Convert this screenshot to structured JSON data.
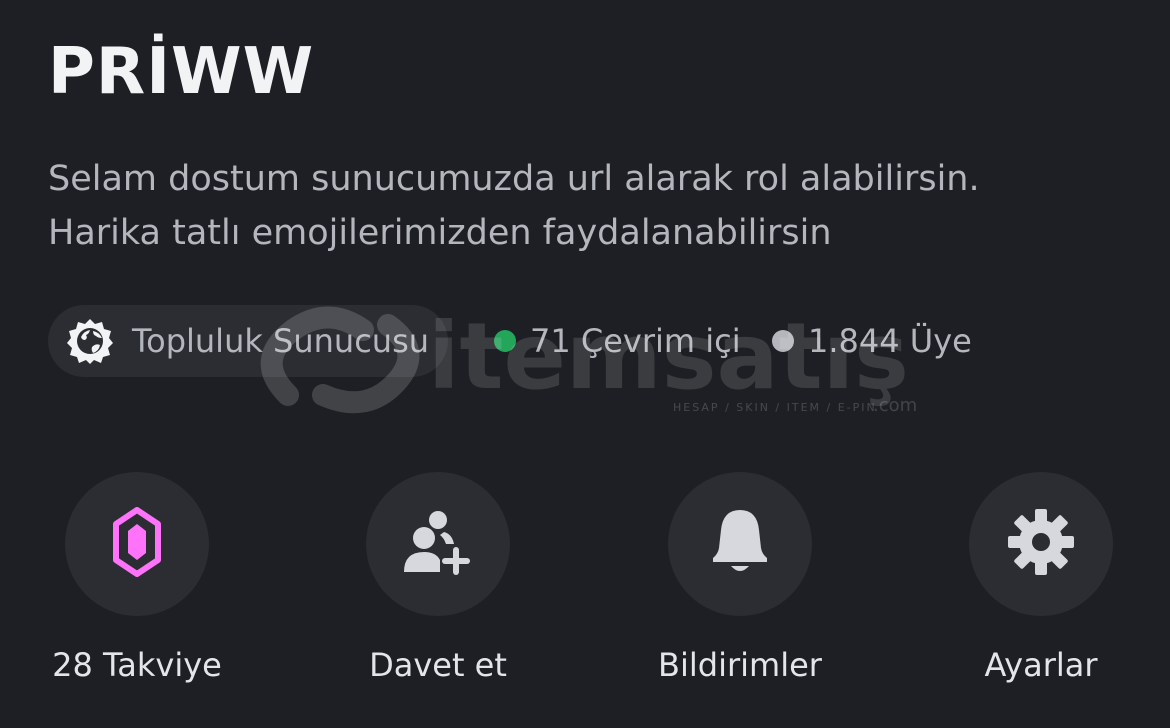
{
  "server": {
    "name": "PRİWW",
    "description_lines": [
      "Selam dostum sunucumuzda url alarak rol alabilirsin.",
      "Harika tatlı emojilerimizden faydalanabilirsin"
    ]
  },
  "community": {
    "label": "Topluluk Sunucusu",
    "icon": "community-badge-icon"
  },
  "stats": {
    "online": {
      "text": "71 Çevrim içi",
      "dot_color": "#23a55a"
    },
    "members": {
      "text": "1.844 Üye",
      "dot_color": "#b4b6bd"
    }
  },
  "watermark": {
    "brand": "itemsatış",
    "tagline": "HESAP / SKIN / ITEM / E-PIN",
    "suffix": ".com"
  },
  "actions": [
    {
      "label": "28 Takviye",
      "icon": "boost-gem-icon",
      "accent": "#ff73fa"
    },
    {
      "label": "Davet et",
      "icon": "invite-user-icon"
    },
    {
      "label": "Bildirimler",
      "icon": "bell-icon"
    },
    {
      "label": "Ayarlar",
      "icon": "gear-icon"
    }
  ],
  "colors": {
    "background": "#1e1f24",
    "surface": "#2b2d33",
    "text_primary": "#f2f3f5",
    "text_secondary": "#b4b6bd",
    "icon": "#d6d8dd"
  }
}
